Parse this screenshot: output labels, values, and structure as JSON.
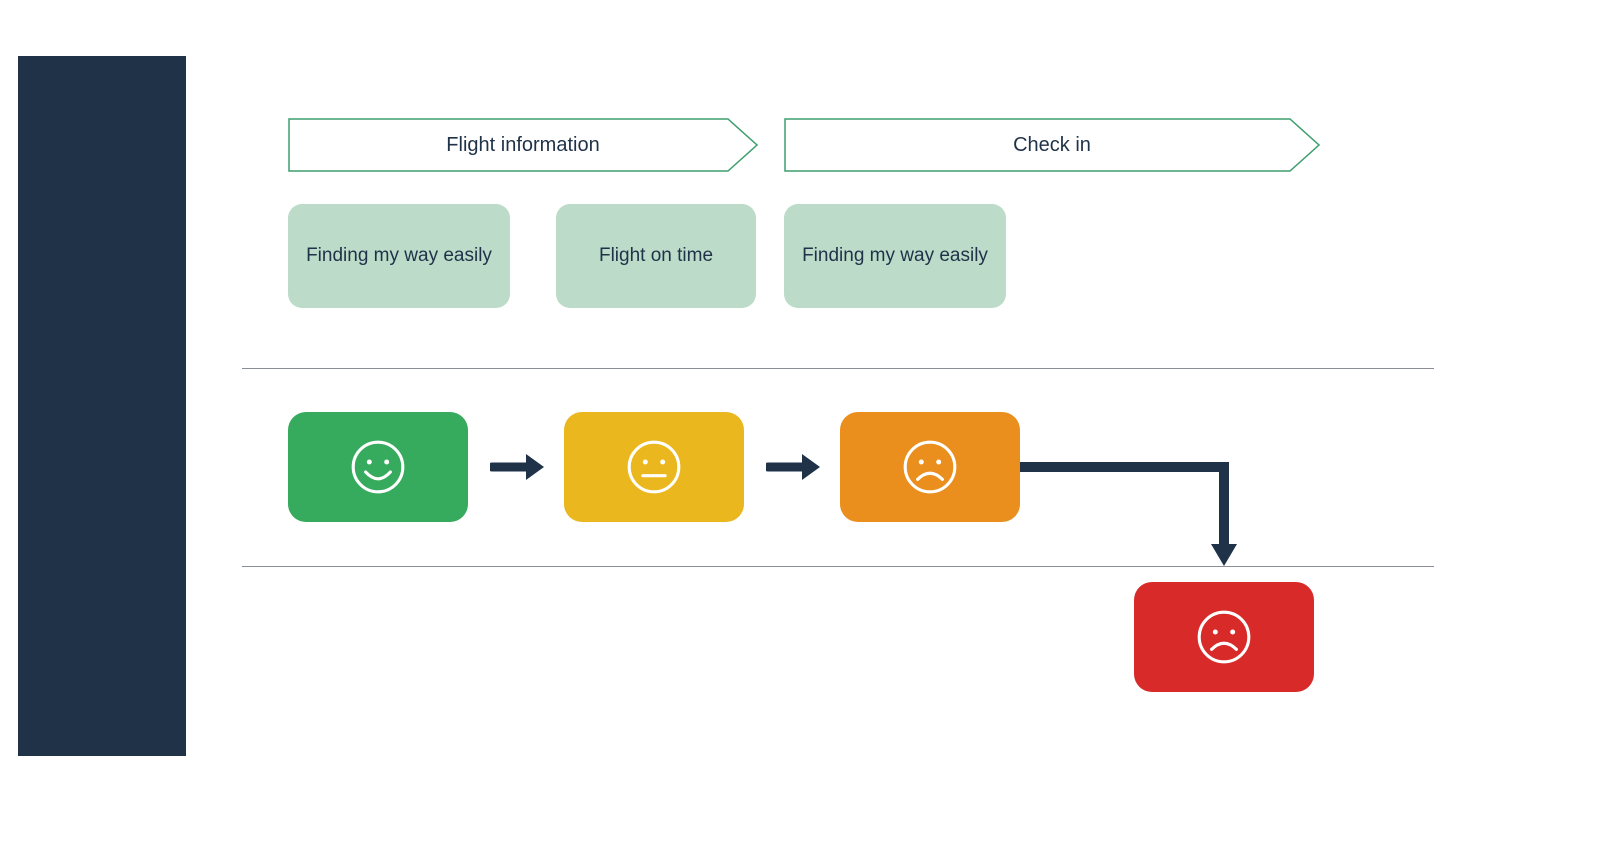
{
  "colors": {
    "navy": "#1f3248",
    "greenStroke": "#3e9e6f",
    "cardBg": "#bcdbc9",
    "divider": "#8a8f95",
    "faceGreen": "#36aa5d",
    "faceYellow": "#eab71e",
    "faceOrange": "#ea8f1e",
    "faceRed": "#d92a2a",
    "faceStroke": "#ffffff"
  },
  "phases": [
    {
      "label": "Flight information"
    },
    {
      "label": "Check in"
    }
  ],
  "subcards": [
    {
      "label": "Finding my way easily"
    },
    {
      "label": "Flight on time"
    },
    {
      "label": "Finding my way easily"
    }
  ],
  "faces": [
    {
      "mood": "happy"
    },
    {
      "mood": "neutral"
    },
    {
      "mood": "sad"
    },
    {
      "mood": "sad"
    }
  ]
}
